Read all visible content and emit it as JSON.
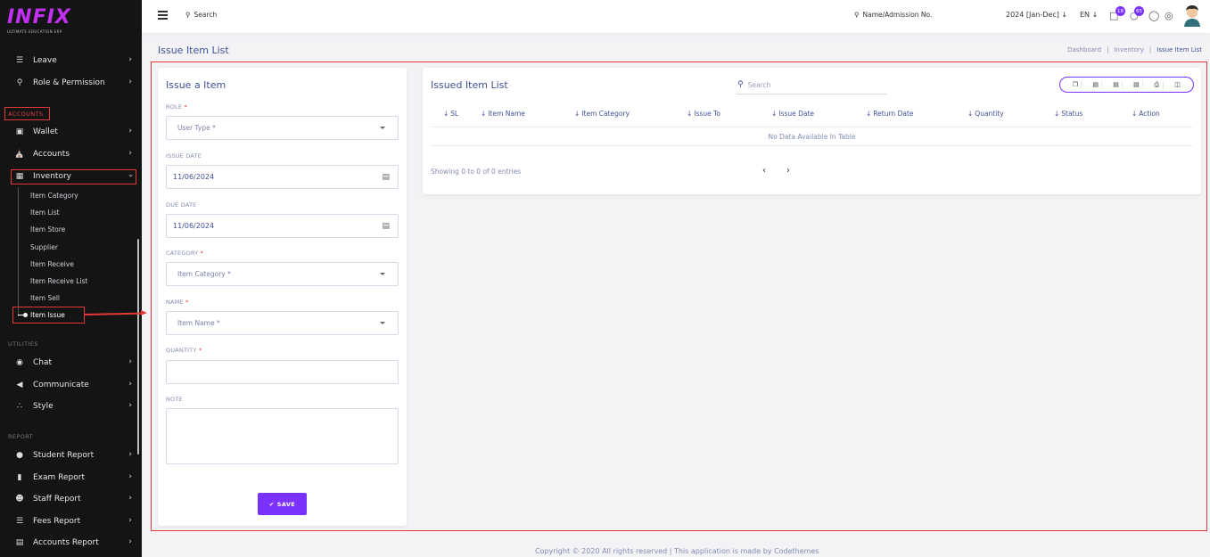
{
  "app": {
    "logo_text": "INFIX",
    "logo_subtitle": "ULTIMATE EDUCATION ERP"
  },
  "sidebar": {
    "items_top": [
      {
        "label": "Leave",
        "icon": "leave-icon"
      },
      {
        "label": "Role & Permission",
        "icon": "key-icon"
      }
    ],
    "section_accounts": "ACCOUNTS",
    "items_accounts": [
      {
        "label": "Wallet",
        "icon": "wallet-icon"
      },
      {
        "label": "Accounts",
        "icon": "bank-icon"
      },
      {
        "label": "Inventory",
        "icon": "inventory-icon"
      }
    ],
    "inventory_sub": [
      "Item Category",
      "Item List",
      "Item Store",
      "Supplier",
      "Item Receive",
      "Item Receive List",
      "Item Sell",
      "Item Issue"
    ],
    "section_utilities": "UTILITIES",
    "items_utilities": [
      {
        "label": "Chat",
        "icon": "chat-icon"
      },
      {
        "label": "Communicate",
        "icon": "megaphone-icon"
      },
      {
        "label": "Style",
        "icon": "style-icon"
      }
    ],
    "section_report": "REPORT",
    "items_report": [
      {
        "label": "Student Report",
        "icon": "users-icon"
      },
      {
        "label": "Exam Report",
        "icon": "book-icon"
      },
      {
        "label": "Staff Report",
        "icon": "staff-icon"
      },
      {
        "label": "Fees Report",
        "icon": "fees-icon"
      },
      {
        "label": "Accounts Report",
        "icon": "money-icon"
      }
    ]
  },
  "topbar": {
    "search_label": "Search",
    "name_search_label": "Name/Admission No.",
    "session": "2024 [Jan-Dec]",
    "language": "EN",
    "chat_badge": "18",
    "notification_badge": "65"
  },
  "page": {
    "title": "Issue Item List",
    "breadcrumb": [
      "Dashboard",
      "Inventory",
      "Issue Item List"
    ]
  },
  "form": {
    "title": "Issue a Item",
    "role_label": "ROLE",
    "role_placeholder": "User Type *",
    "issue_date_label": "ISSUE DATE",
    "issue_date_value": "11/06/2024",
    "due_date_label": "DUE DATE",
    "due_date_value": "11/06/2024",
    "category_label": "CATEGORY",
    "category_placeholder": "Item Category *",
    "name_label": "NAME",
    "name_placeholder": "Item Name *",
    "quantity_label": "QUANTITY",
    "note_label": "NOTE",
    "save_label": "SAVE",
    "required_mark": "*"
  },
  "list": {
    "title": "Issued Item List",
    "search_placeholder": "Search",
    "columns": [
      "SL",
      "Item Name",
      "Item Category",
      "Issue To",
      "Issue Date",
      "Return Date",
      "Quantity",
      "Status",
      "Action"
    ],
    "no_data": "No Data Available In Table",
    "showing": "Showing 0 to 0 of 0 entries"
  },
  "footer": {
    "text": "Copyright © 2020 All rights reserved | This application is made by Codethemes"
  },
  "colors": {
    "accent": "#7c32ff",
    "highlight": "#e53935",
    "text": "#415094"
  }
}
